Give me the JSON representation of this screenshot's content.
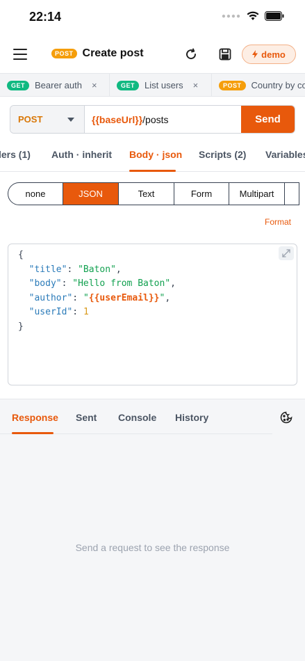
{
  "status_bar": {
    "time": "22:14"
  },
  "header": {
    "method_badge": "POST",
    "title": "Create post",
    "icons": [
      "menu-icon",
      "refresh-icon",
      "save-icon",
      "bolt-icon"
    ],
    "env_label": "demo"
  },
  "request_tabs": [
    {
      "method": "GET",
      "label": "Bearer auth",
      "close": "×"
    },
    {
      "method": "GET",
      "label": "List users",
      "close": "×"
    },
    {
      "method": "POST",
      "label": "Country by co"
    }
  ],
  "url_bar": {
    "method": "POST",
    "url_var": "{{baseUrl}}",
    "url_path": "/posts",
    "send_label": "Send"
  },
  "sub_tabs": [
    "lers (1)",
    "Auth · inherit",
    "Body · json",
    "Scripts (2)",
    "Variables"
  ],
  "active_sub_tab": "Body · json",
  "body_modes": [
    "none",
    "JSON",
    "Text",
    "Form",
    "Multipart"
  ],
  "active_body_mode": "JSON",
  "format_label": "Format",
  "editor": {
    "open": "{",
    "close": "}",
    "fields": [
      {
        "key": "\"title\"",
        "value": "\"Baton\""
      },
      {
        "key": "\"body\"",
        "value": "\"Hello from Baton\""
      },
      {
        "key": "\"author\"",
        "value_pre": "\"",
        "value_var": "{{userEmail}}",
        "value_post": "\""
      },
      {
        "key": "\"userId\"",
        "value": "1"
      }
    ]
  },
  "response": {
    "tabs": [
      "Response",
      "Sent",
      "Console",
      "History"
    ],
    "active_tab": "Response",
    "empty_message": "Send a request to see the response"
  },
  "colors": {
    "accent": "#e8590c",
    "get": "#10b981",
    "post": "#f59e0b"
  }
}
